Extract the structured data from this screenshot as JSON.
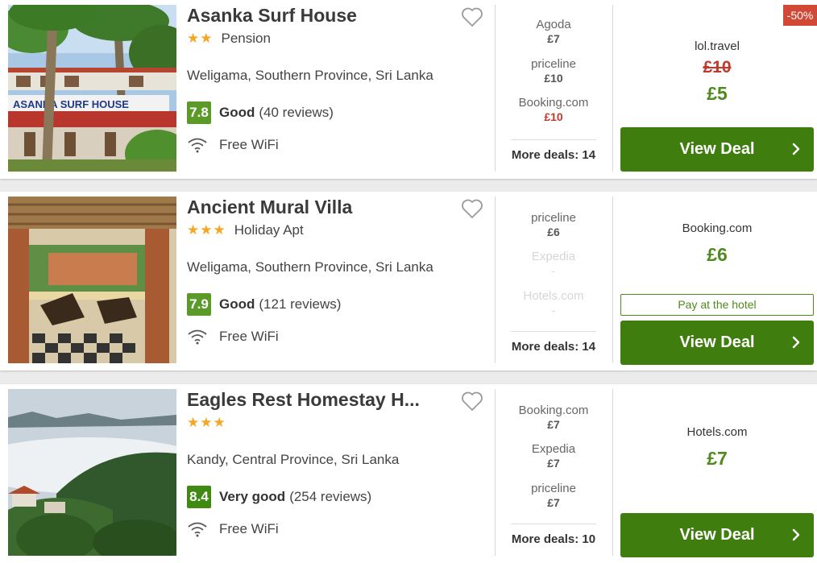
{
  "hotels": [
    {
      "name": "Asanka Surf House",
      "stars": "★★",
      "type": "Pension",
      "location": "Weligama, Southern Province, Sri Lanka",
      "score": "7.8",
      "score_color": "#5b9a28",
      "rating_word": "Good",
      "review_count": "(40 reviews)",
      "amenity": "Free WiFi",
      "photo_sign": "ASANKA SURF HOUSE",
      "deals": [
        {
          "provider": "Agoda",
          "price": "£7"
        },
        {
          "provider": "priceline",
          "price": "£10"
        },
        {
          "provider": "Booking.com",
          "price": "£10"
        }
      ],
      "more_deals": "More deals: 14",
      "best_provider": "lol.travel",
      "old_price": "£10",
      "best_price": "£5",
      "discount": "-50%",
      "view_deal": "View Deal"
    },
    {
      "name": "Ancient Mural Villa",
      "stars": "★★★",
      "type": "Holiday Apt",
      "location": "Weligama, Southern Province, Sri Lanka",
      "score": "7.9",
      "score_color": "#5b9a28",
      "rating_word": "Good",
      "review_count": "(121 reviews)",
      "amenity": "Free WiFi",
      "deals": [
        {
          "provider": "priceline",
          "price": "£6"
        },
        {
          "provider": "Expedia",
          "price": "-"
        },
        {
          "provider": "Hotels.com",
          "price": "-"
        }
      ],
      "more_deals": "More deals: 14",
      "best_provider": "Booking.com",
      "best_price": "£6",
      "pay_at_hotel": "Pay at the hotel",
      "view_deal": "View Deal"
    },
    {
      "name": "Eagles Rest Homestay H...",
      "stars": "★★★",
      "location": "Kandy, Central Province, Sri Lanka",
      "score": "8.4",
      "score_color": "#3f8a12",
      "rating_word": "Very good",
      "review_count": "(254 reviews)",
      "amenity": "Free WiFi",
      "deals": [
        {
          "provider": "Booking.com",
          "price": "£7"
        },
        {
          "provider": "Expedia",
          "price": "£7"
        },
        {
          "provider": "priceline",
          "price": "£7"
        }
      ],
      "more_deals": "More deals: 10",
      "best_provider": "Hotels.com",
      "best_price": "£7",
      "view_deal": "View Deal"
    }
  ],
  "colors": {
    "deal_button": "#3f7d0f",
    "best_price": "#4e8a1d",
    "strike_price": "#c0392b",
    "discount_badge": "#d14836",
    "stars": "#f5a623"
  },
  "icons": {
    "favorite": "heart-outline-icon",
    "wifi": "wifi-icon",
    "arrow": "chevron-right-icon"
  }
}
